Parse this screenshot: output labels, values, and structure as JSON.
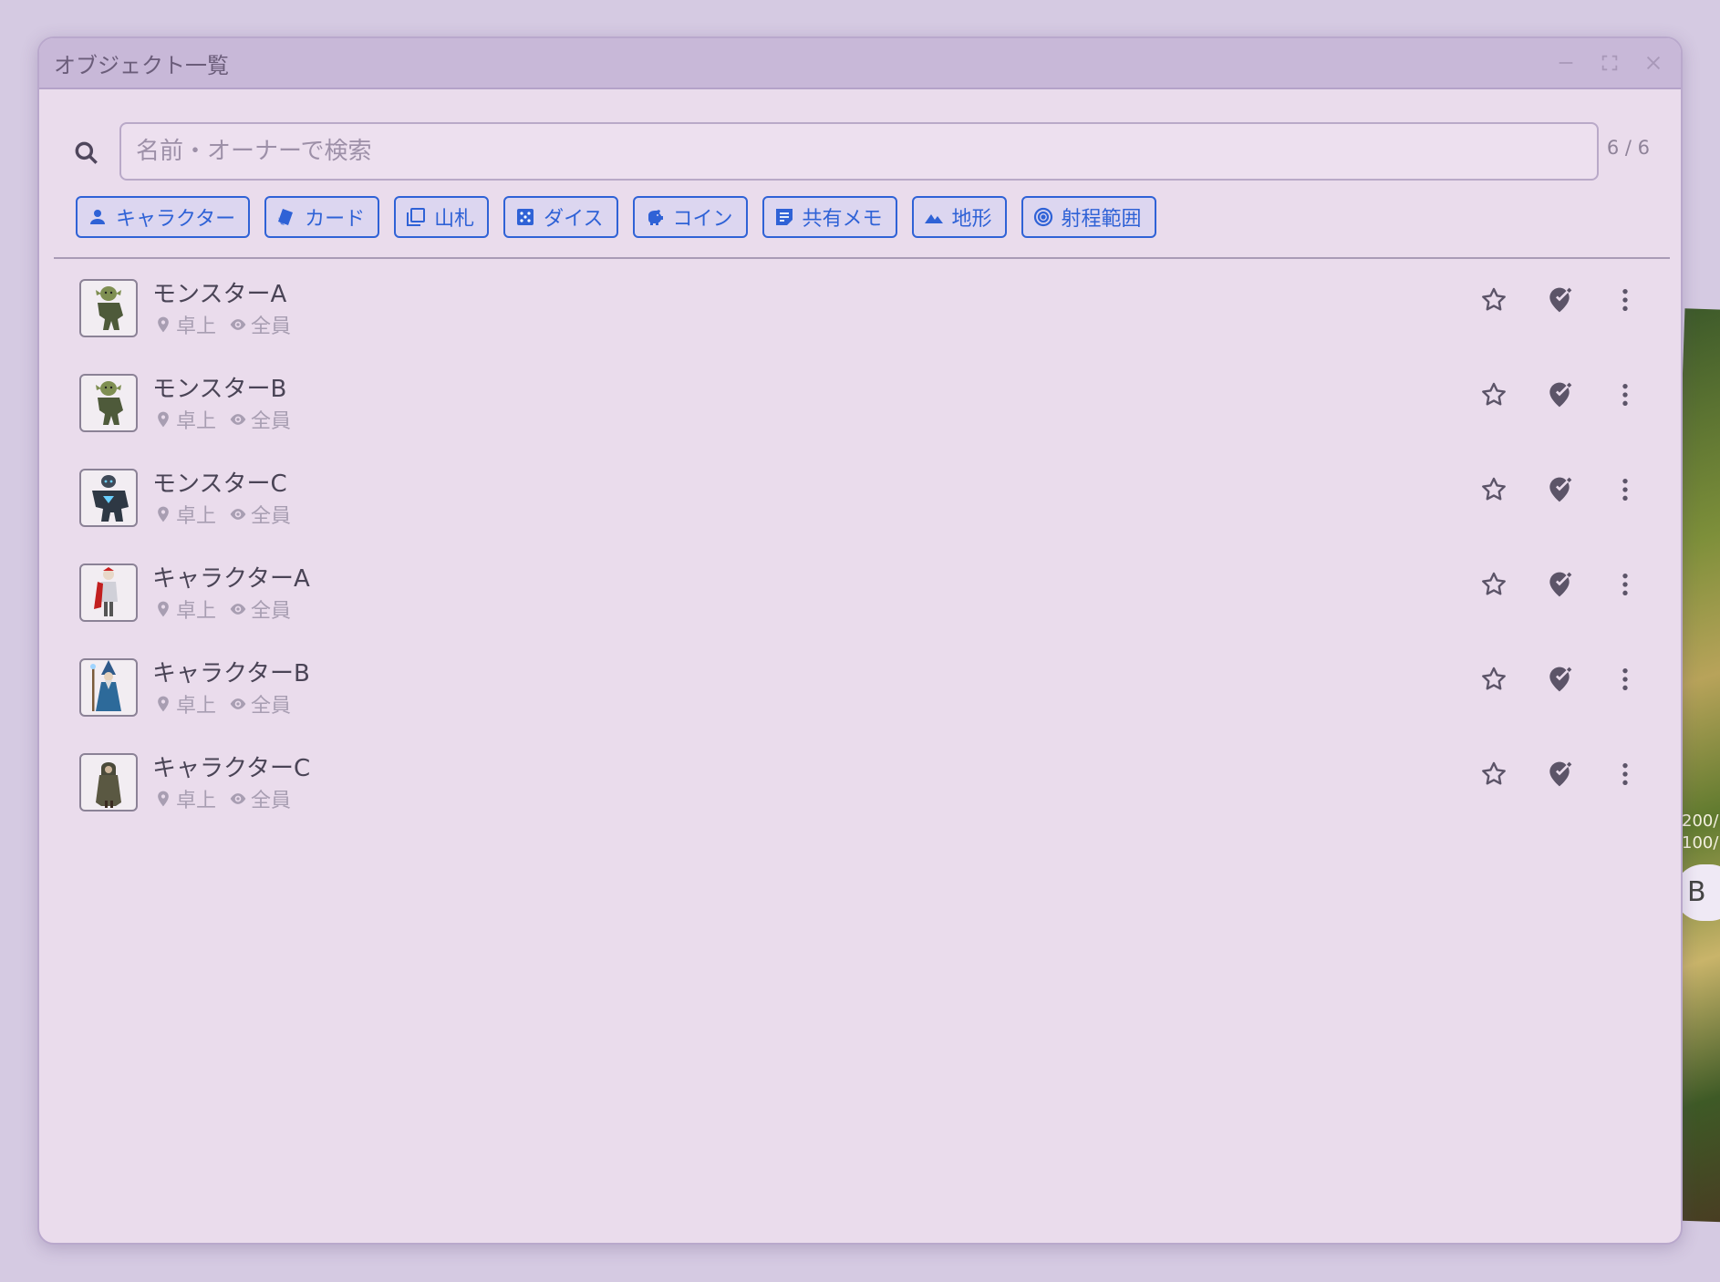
{
  "window": {
    "title": "オブジェクト一覧"
  },
  "search": {
    "placeholder": "名前・オーナーで検索",
    "value": "",
    "count": "6 / 6"
  },
  "filters": [
    {
      "label": "キャラクター",
      "icon": "person-icon"
    },
    {
      "label": "カード",
      "icon": "cards-icon"
    },
    {
      "label": "山札",
      "icon": "deck-icon"
    },
    {
      "label": "ダイス",
      "icon": "dice-icon"
    },
    {
      "label": "コイン",
      "icon": "piggy-bank-icon"
    },
    {
      "label": "共有メモ",
      "icon": "note-icon"
    },
    {
      "label": "地形",
      "icon": "terrain-icon"
    },
    {
      "label": "射程範囲",
      "icon": "target-icon"
    }
  ],
  "objects": [
    {
      "name": "モンスターA",
      "location": "卓上",
      "visibility": "全員",
      "avatar": "goblin"
    },
    {
      "name": "モンスターB",
      "location": "卓上",
      "visibility": "全員",
      "avatar": "goblin"
    },
    {
      "name": "モンスターC",
      "location": "卓上",
      "visibility": "全員",
      "avatar": "golem"
    },
    {
      "name": "キャラクターA",
      "location": "卓上",
      "visibility": "全員",
      "avatar": "knight"
    },
    {
      "name": "キャラクターB",
      "location": "卓上",
      "visibility": "全員",
      "avatar": "wizard"
    },
    {
      "name": "キャラクターC",
      "location": "卓上",
      "visibility": "全員",
      "avatar": "ranger"
    }
  ],
  "background": {
    "hp_line1": "200/",
    "hp_line2": "100/",
    "badge": "B"
  },
  "colors": {
    "accent": "#2f62d6",
    "window_bg": "#eadcec",
    "titlebar_bg": "#c8b8d8"
  }
}
